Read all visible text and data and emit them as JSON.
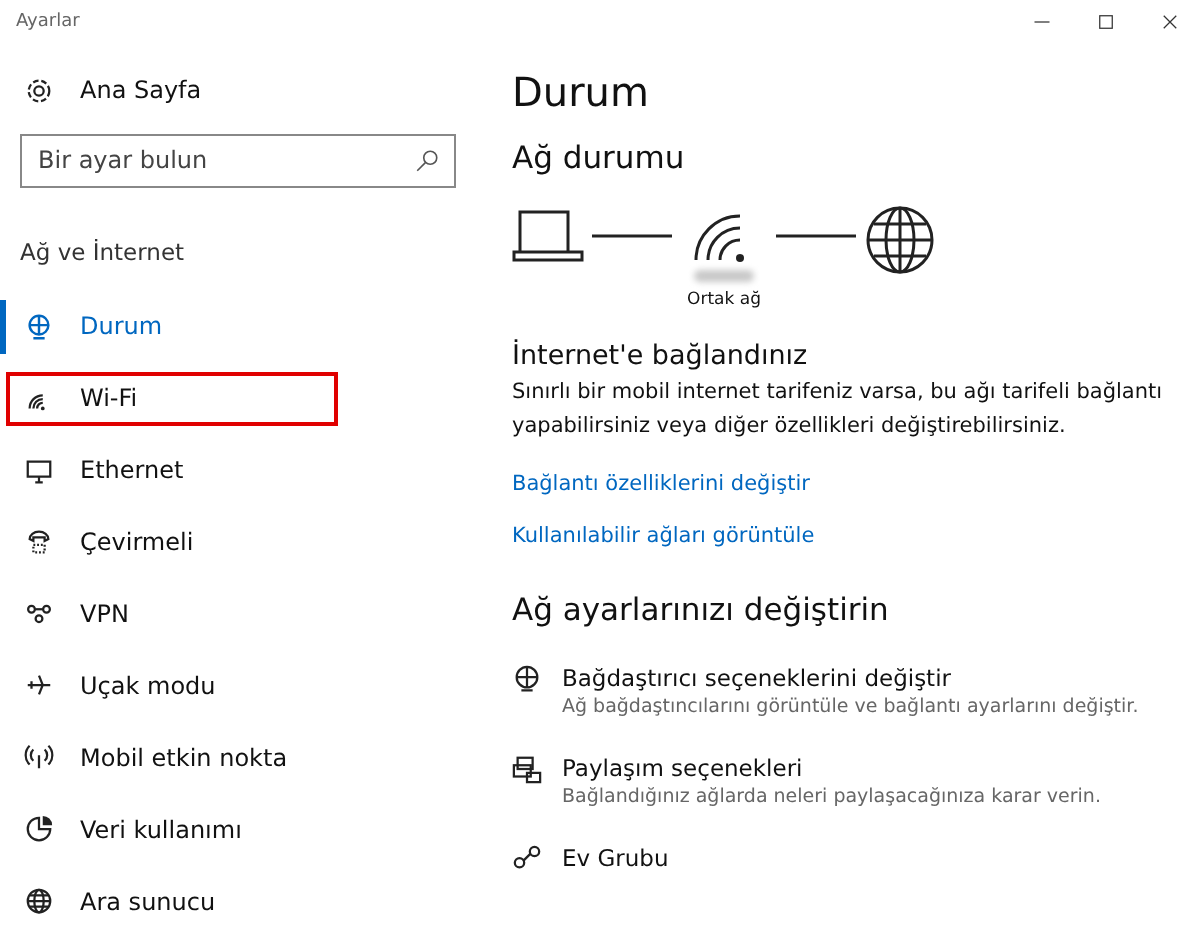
{
  "window": {
    "title": "Ayarlar"
  },
  "sidebar": {
    "home": "Ana Sayfa",
    "search": {
      "placeholder": "Bir ayar bulun"
    },
    "section": "Ağ ve İnternet",
    "items": [
      {
        "label": "Durum",
        "selected": true,
        "highlighted": false
      },
      {
        "label": "Wi-Fi",
        "selected": false,
        "highlighted": true
      },
      {
        "label": "Ethernet",
        "selected": false,
        "highlighted": false
      },
      {
        "label": "Çevirmeli",
        "selected": false,
        "highlighted": false
      },
      {
        "label": "VPN",
        "selected": false,
        "highlighted": false
      },
      {
        "label": "Uçak modu",
        "selected": false,
        "highlighted": false
      },
      {
        "label": "Mobil etkin nokta",
        "selected": false,
        "highlighted": false
      },
      {
        "label": "Veri kullanımı",
        "selected": false,
        "highlighted": false
      },
      {
        "label": "Ara sunucu",
        "selected": false,
        "highlighted": false
      }
    ]
  },
  "content": {
    "title": "Durum",
    "network_heading": "Ağ durumu",
    "network_type": "Ortak ağ",
    "connected_title": "İnternet'e bağlandınız",
    "connected_text": "Sınırlı bir mobil internet tarifeniz varsa, bu ağı tarifeli bağlantı yapabilirsiniz veya diğer özellikleri değiştirebilirsiniz.",
    "links": [
      "Bağlantı özelliklerini değiştir",
      "Kullanılabilir ağları görüntüle"
    ],
    "settings_heading": "Ağ ayarlarınızı değiştirin",
    "settings": [
      {
        "title": "Bağdaştırıcı seçeneklerini değiştir",
        "description": "Ağ bağdaştıncılarını görüntüle ve bağlantı ayarlarını değiştir."
      },
      {
        "title": "Paylaşım seçenekleri",
        "description": "Bağlandığınız ağlarda neleri paylaşacağınıza karar verin."
      },
      {
        "title": "Ev Grubu"
      }
    ]
  }
}
